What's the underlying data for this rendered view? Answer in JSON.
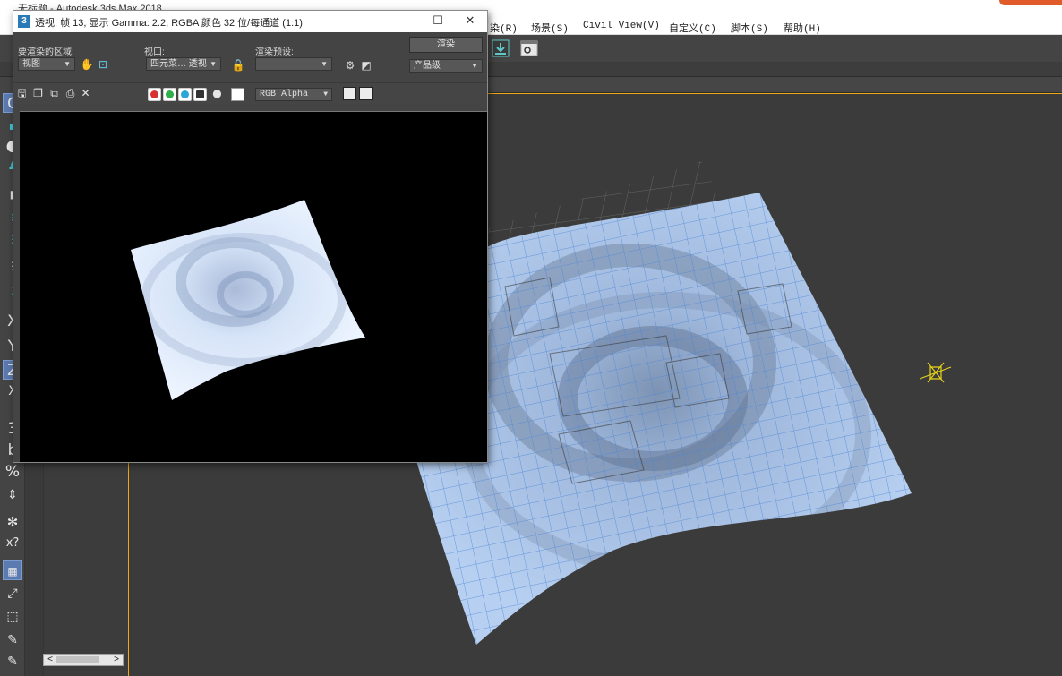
{
  "main_window": {
    "title": "无标题 - Autodesk 3ds Max 2018",
    "menu": [
      "染(R)",
      "场景(S)",
      "Civil View(V)",
      "自定义(C)",
      "脚本(S)",
      "帮助(H)"
    ]
  },
  "render_window": {
    "title": "透视, 帧 13, 显示 Gamma: 2.2, RGBA 颜色 32 位/每通道 (1:1)",
    "area_label": "要渲染的区域:",
    "area_value": "视图",
    "viewport_label": "视口:",
    "viewport_value": "四元菜… 透视",
    "preset_label": "渲染预设:",
    "preset_value": "",
    "render_button": "渲染",
    "quality_value": "产品级",
    "channel_value": "RGB Alpha"
  },
  "icons": {
    "min": "—",
    "max": "☐",
    "close": "✕"
  },
  "colors": {
    "viewport_border": "#f2a61c",
    "cloth": "#9fc0e8",
    "render_cloth": "#dce9fb",
    "gizmo": "#e7d21a"
  },
  "scrollbar": {
    "left": "<",
    "right": ">"
  }
}
